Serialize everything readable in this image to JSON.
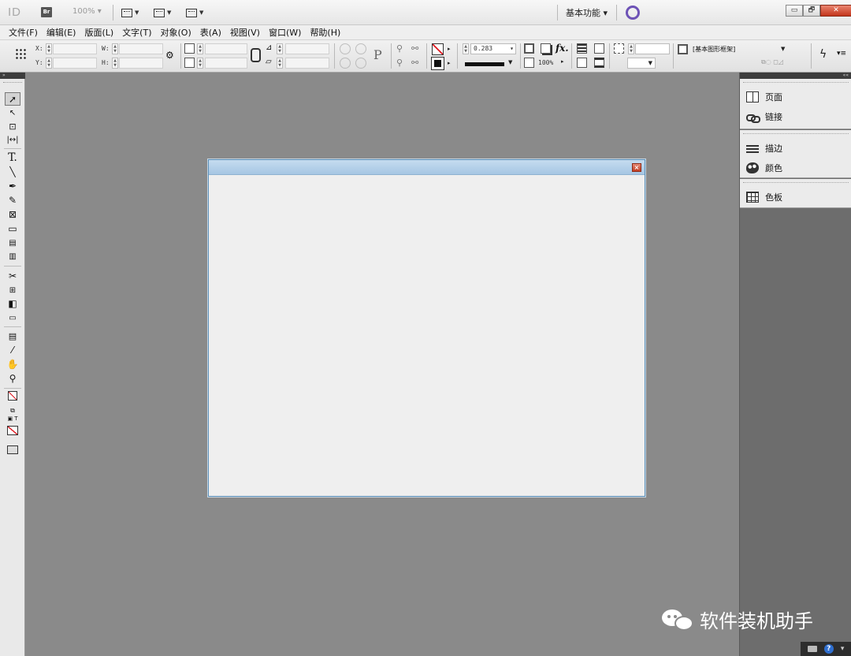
{
  "app": {
    "logo_text": "ID",
    "bridge_label": "Br",
    "zoom": "100%",
    "workspace_label": "基本功能 ▾"
  },
  "window_controls": {
    "minimize": "▭",
    "restore": "🗗",
    "close": "✕"
  },
  "menu": {
    "items": [
      {
        "label": "文件(F)"
      },
      {
        "label": "编辑(E)"
      },
      {
        "label": "版面(L)"
      },
      {
        "label": "文字(T)"
      },
      {
        "label": "对象(O)"
      },
      {
        "label": "表(A)"
      },
      {
        "label": "视图(V)"
      },
      {
        "label": "窗口(W)"
      },
      {
        "label": "帮助(H)"
      }
    ]
  },
  "control": {
    "x_label": "X:",
    "y_label": "Y:",
    "w_label": "W:",
    "h_label": "H:",
    "stroke_weight": "0.283",
    "opacity": "100%",
    "object_style": "[基本图形框架]"
  },
  "panels": {
    "items": [
      {
        "label": "页面",
        "icon": "pages-icon"
      },
      {
        "label": "链接",
        "icon": "links-icon"
      },
      {
        "label": "描边",
        "icon": "stroke-icon"
      },
      {
        "label": "颜色",
        "icon": "color-icon"
      },
      {
        "label": "色板",
        "icon": "swatches-icon"
      }
    ]
  },
  "watermark": {
    "text": "软件装机助手"
  },
  "colors": {
    "dialog_title": "#b3d0ea",
    "background": "#8a8a8a",
    "accent_ring": "#6d52b6",
    "close_red": "#c2351b"
  }
}
